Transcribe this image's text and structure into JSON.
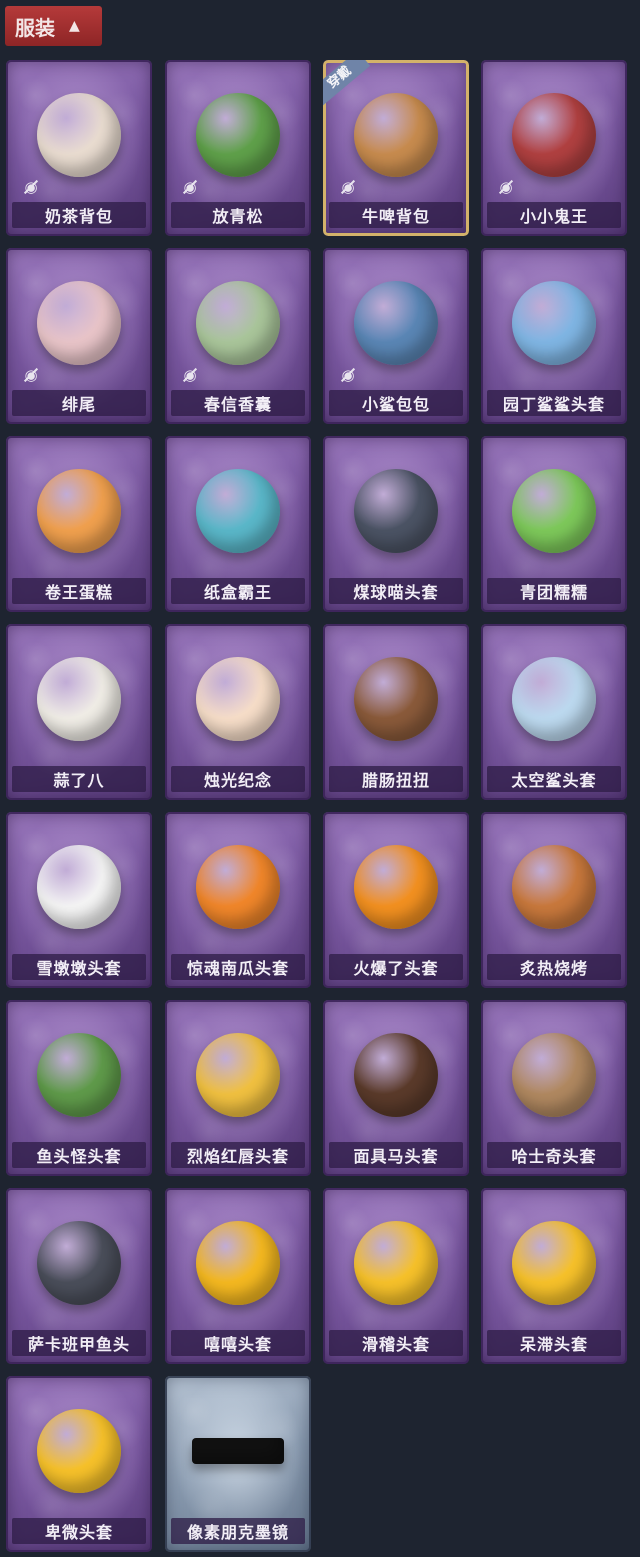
{
  "section": {
    "title": "服装",
    "toggle_icon": "chevron-up-icon"
  },
  "status": {
    "equipped_label": "穿戴",
    "hidden_icon": "eye-off-icon"
  },
  "items": [
    {
      "name": "奶茶背包",
      "color": "#e9dcd0",
      "hidden": true
    },
    {
      "name": "放青松",
      "color": "#5fa04a",
      "hidden": true
    },
    {
      "name": "牛啤背包",
      "color": "#c78b4e",
      "hidden": true,
      "equipped": true
    },
    {
      "name": "小小鬼王",
      "color": "#b04040",
      "hidden": true
    },
    {
      "name": "绯尾",
      "color": "#e8c4c8",
      "hidden": true
    },
    {
      "name": "春信香囊",
      "color": "#a9c59a",
      "hidden": true
    },
    {
      "name": "小鲨包包",
      "color": "#5a86b5",
      "hidden": true
    },
    {
      "name": "园丁鲨鲨头套",
      "color": "#7fb5e3"
    },
    {
      "name": "卷王蛋糕",
      "color": "#f0a04e"
    },
    {
      "name": "纸盒霸王",
      "color": "#5ab7c9"
    },
    {
      "name": "煤球喵头套",
      "color": "#4b5364"
    },
    {
      "name": "青团糯糯",
      "color": "#7dc85a"
    },
    {
      "name": "蒜了八",
      "color": "#f0ede6"
    },
    {
      "name": "烛光纪念",
      "color": "#f6ddc8"
    },
    {
      "name": "腊肠扭扭",
      "color": "#8a5a3a"
    },
    {
      "name": "太空鲨头套",
      "color": "#bcd9ef"
    },
    {
      "name": "雪墩墩头套",
      "color": "#f4f4f4"
    },
    {
      "name": "惊魂南瓜头套",
      "color": "#f0862a"
    },
    {
      "name": "火爆了头套",
      "color": "#f29020"
    },
    {
      "name": "炙热烧烤",
      "color": "#c8783c"
    },
    {
      "name": "鱼头怪头套",
      "color": "#5f9a4a"
    },
    {
      "name": "烈焰红唇头套",
      "color": "#f0c040"
    },
    {
      "name": "面具马头套",
      "color": "#5a3a2a"
    },
    {
      "name": "哈士奇头套",
      "color": "#b08860"
    },
    {
      "name": "萨卡班甲鱼头",
      "color": "#4a4e5a"
    },
    {
      "name": "嘻嘻头套",
      "color": "#f4b820"
    },
    {
      "name": "滑稽头套",
      "color": "#f6c12a"
    },
    {
      "name": "呆滞头套",
      "color": "#f6c12a"
    },
    {
      "name": "卑微头套",
      "color": "#f6c12a"
    },
    {
      "name": "像素朋克墨镜",
      "color": "#222222",
      "rare": true
    }
  ]
}
